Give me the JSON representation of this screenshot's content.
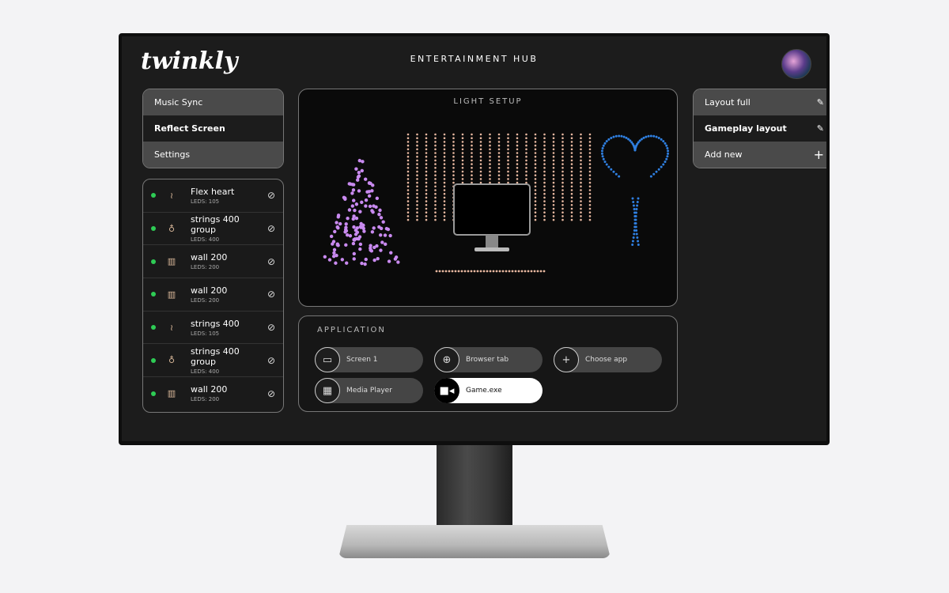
{
  "header": {
    "logo": "twinkly",
    "title": "ENTERTAINMENT HUB"
  },
  "modes": [
    {
      "label": "Music Sync",
      "selected": false
    },
    {
      "label": "Reflect Screen",
      "selected": true
    },
    {
      "label": "Settings",
      "selected": false
    }
  ],
  "devices": [
    {
      "name": "Flex heart",
      "leds": "LEDS: 105",
      "icon": "flex-icon"
    },
    {
      "name": "strings 400 group",
      "leds": "LEDS: 400",
      "icon": "bulbs-icon"
    },
    {
      "name": "wall 200",
      "leds": "LEDS: 200",
      "icon": "wall-icon"
    },
    {
      "name": "wall 200",
      "leds": "LEDS: 200",
      "icon": "wall-icon"
    },
    {
      "name": "strings 400",
      "leds": "LEDS: 105",
      "icon": "flex-icon"
    },
    {
      "name": "strings 400 group",
      "leds": "LEDS: 400",
      "icon": "bulbs-icon"
    },
    {
      "name": "wall 200",
      "leds": "LEDS: 200",
      "icon": "wall-icon"
    }
  ],
  "light_setup": {
    "title": "LIGHT SETUP",
    "colors": {
      "tree": "#c98af0",
      "strings": "#e8b8a0",
      "heart": "#2f7fe0"
    }
  },
  "application": {
    "title": "APPLICATION",
    "apps": [
      {
        "label": "Screen 1",
        "icon": "monitor-icon",
        "active": false
      },
      {
        "label": "Browser tab",
        "icon": "globe-icon",
        "active": false
      },
      {
        "label": "Choose app",
        "icon": "plus-icon",
        "active": false
      },
      {
        "label": "Media Player",
        "icon": "film-icon",
        "active": false
      },
      {
        "label": "Game.exe",
        "icon": "video-camera-icon",
        "active": true
      }
    ]
  },
  "layouts": [
    {
      "label": "Layout full",
      "icon": "pencil-icon",
      "selected": false
    },
    {
      "label": "Gameplay layout",
      "icon": "pencil-icon",
      "selected": true
    },
    {
      "label": "Add new",
      "icon": "plus-icon",
      "selected": false
    }
  ]
}
